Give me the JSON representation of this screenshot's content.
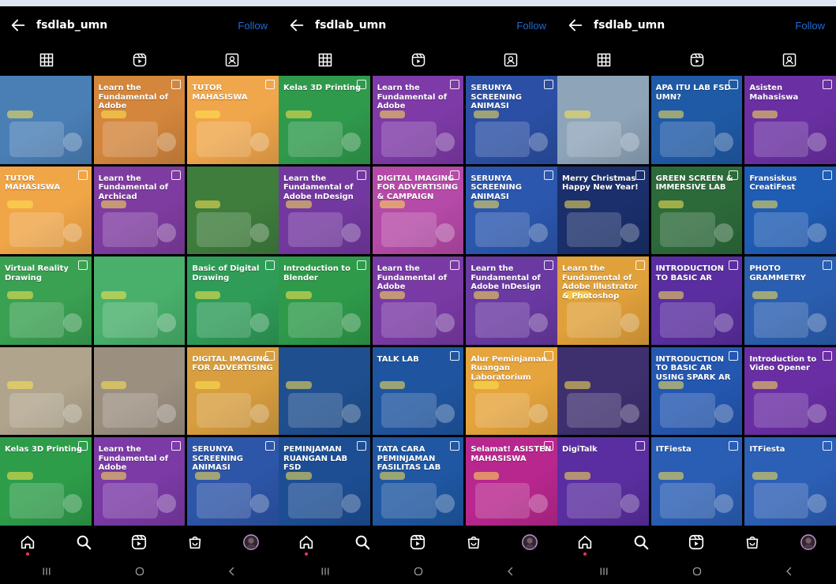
{
  "screens": [
    {
      "username": "fsdlab_umn",
      "follow_label": "Follow",
      "tiles": [
        {
          "caption": "",
          "color": "#4a7fb6"
        },
        {
          "caption": "Learn the Fundamental of Adobe",
          "color": "#d3863c"
        },
        {
          "caption": "TUTOR MAHASISWA",
          "color": "#f0a64a"
        },
        {
          "caption": "TUTOR MAHASISWA",
          "color": "#f0a547"
        },
        {
          "caption": "Learn the Fundamental of Archicad",
          "color": "#7f3ca0"
        },
        {
          "caption": "",
          "color": "#3e7d3c"
        },
        {
          "caption": "Virtual Reality Drawing",
          "color": "#3aa152"
        },
        {
          "caption": "",
          "color": "#48b06b"
        },
        {
          "caption": "Basic of Digital Drawing",
          "color": "#2f9c58"
        },
        {
          "caption": "",
          "color": "#b0a48c"
        },
        {
          "caption": "",
          "color": "#9b8f80"
        },
        {
          "caption": "DIGITAL IMAGING FOR ADVERTISING",
          "color": "#d89e3f"
        },
        {
          "caption": "Kelas 3D Printing",
          "color": "#2e9d4a"
        },
        {
          "caption": "Learn the Fundamental of Adobe",
          "color": "#7b3aa6"
        },
        {
          "caption": "SERUNYA SCREENING ANIMASI",
          "color": "#2d55a8"
        }
      ]
    },
    {
      "username": "fsdlab_umn",
      "follow_label": "Follow",
      "tiles": [
        {
          "caption": "Kelas 3D Printing",
          "color": "#2f9a4c"
        },
        {
          "caption": "Learn the Fundamental of Adobe",
          "color": "#7e3aa7"
        },
        {
          "caption": "SERUNYA SCREENING ANIMASI",
          "color": "#2a4fa4"
        },
        {
          "caption": "Learn the Fundamental of Adobe InDesign",
          "color": "#7338a0"
        },
        {
          "caption": "DIGITAL IMAGING FOR ADVERTISING & CAMPAIGN",
          "color": "#b64aa8"
        },
        {
          "caption": "SERUNYA SCREENING ANIMASI",
          "color": "#2b57ae"
        },
        {
          "caption": "Introduction to Blender",
          "color": "#2e9a4a"
        },
        {
          "caption": "Learn the Fundamental of Adobe",
          "color": "#7a3aa5"
        },
        {
          "caption": "Learn the Fundamental of Adobe InDesign",
          "color": "#6a39a2"
        },
        {
          "caption": "",
          "color": "#1f4f8f"
        },
        {
          "caption": "TALK LAB",
          "color": "#1f55a0"
        },
        {
          "caption": "Alur Peminjaman Ruangan Laboratorium",
          "color": "#e6a43c"
        },
        {
          "caption": "PEMINJAMAN RUANGAN LAB FSD",
          "color": "#1d4e94"
        },
        {
          "caption": "TATA CARA PEMINJAMAN FASILITAS LAB",
          "color": "#1f57a2"
        },
        {
          "caption": "Selamat! ASISTEN MAHASISWA",
          "color": "#b8278e"
        }
      ]
    },
    {
      "username": "fsdlab_umn",
      "follow_label": "Follow",
      "tiles": [
        {
          "caption": "",
          "color": "#8ea4b9"
        },
        {
          "caption": "APA ITU LAB FSD UMN?",
          "color": "#1f5aa6"
        },
        {
          "caption": "Asisten Mahasiswa",
          "color": "#6a2fa2"
        },
        {
          "caption": "Merry Christmas Happy New Year!",
          "color": "#1a2f6b"
        },
        {
          "caption": "GREEN SCREEN & IMMERSIVE LAB",
          "color": "#2c6a3a"
        },
        {
          "caption": "Fransiskus CreatiFest",
          "color": "#1f5cb4"
        },
        {
          "caption": "Learn the Fundamental of Adobe Illustrator & Photoshop",
          "color": "#e0a03a"
        },
        {
          "caption": "INTRODUCTION TO BASIC AR",
          "color": "#5a2ea0"
        },
        {
          "caption": "PHOTO GRAMMETRY",
          "color": "#2a5eb0"
        },
        {
          "caption": "",
          "color": "#3e2f6e"
        },
        {
          "caption": "INTRODUCTION TO BASIC AR USING SPARK AR",
          "color": "#2457b0"
        },
        {
          "caption": "Introduction to Video Opener",
          "color": "#6a2ea4"
        },
        {
          "caption": "DigiTalk",
          "color": "#5a2ea0"
        },
        {
          "caption": "ITFiesta",
          "color": "#2a5eb4"
        },
        {
          "caption": "ITFiesta",
          "color": "#2c5fb6"
        }
      ]
    }
  ],
  "icons": {
    "back": "back-arrow-icon",
    "grid": "grid-icon",
    "reels": "reels-icon",
    "tagged": "tagged-icon",
    "home": "home-icon",
    "search": "search-icon",
    "reels_nav": "reels-icon",
    "shop": "shop-icon",
    "avatar": "avatar"
  },
  "accent": "#1f6bd6",
  "notification_dot": "#ff2d55"
}
